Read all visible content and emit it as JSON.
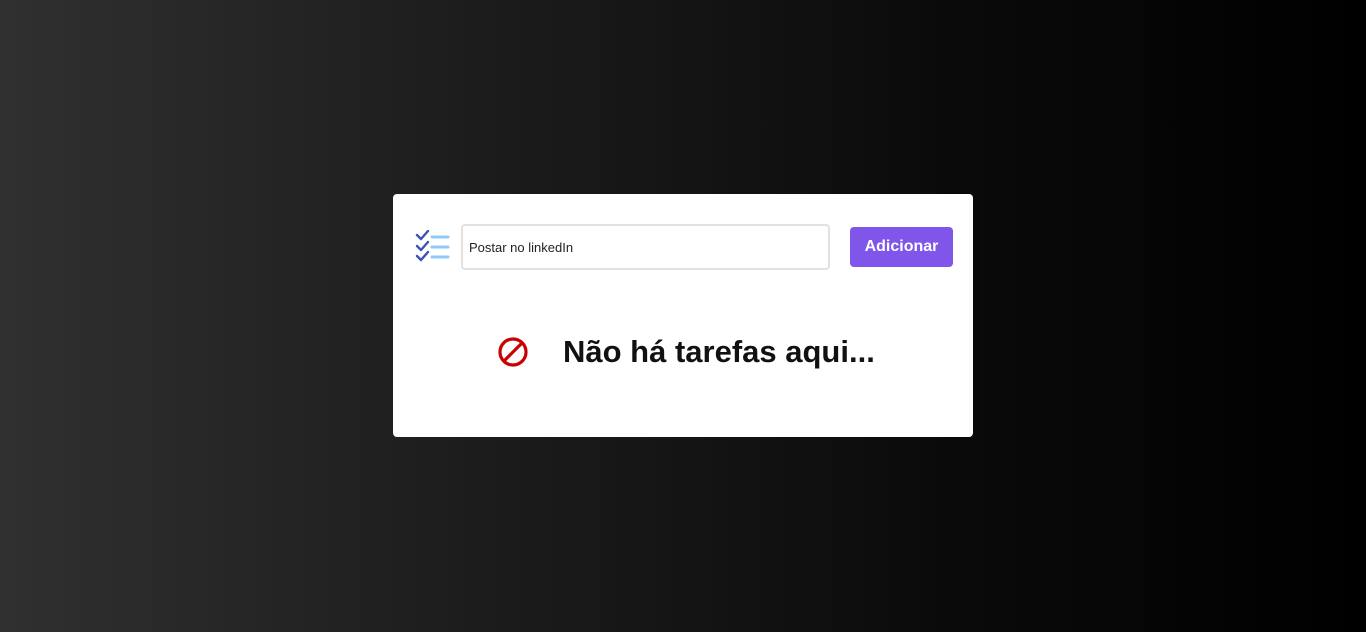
{
  "todo": {
    "input": {
      "value": "Postar no linkedIn",
      "placeholder": ""
    },
    "add_button_label": "Adicionar",
    "empty_message": "Não há tarefas aqui...",
    "icons": {
      "list": "checklist-icon",
      "empty": "ban-icon"
    },
    "colors": {
      "accent": "#7f55ea",
      "empty_icon": "#cc0000",
      "checkmarks": "#3f51b5",
      "list_lines": "#90caf9"
    }
  }
}
